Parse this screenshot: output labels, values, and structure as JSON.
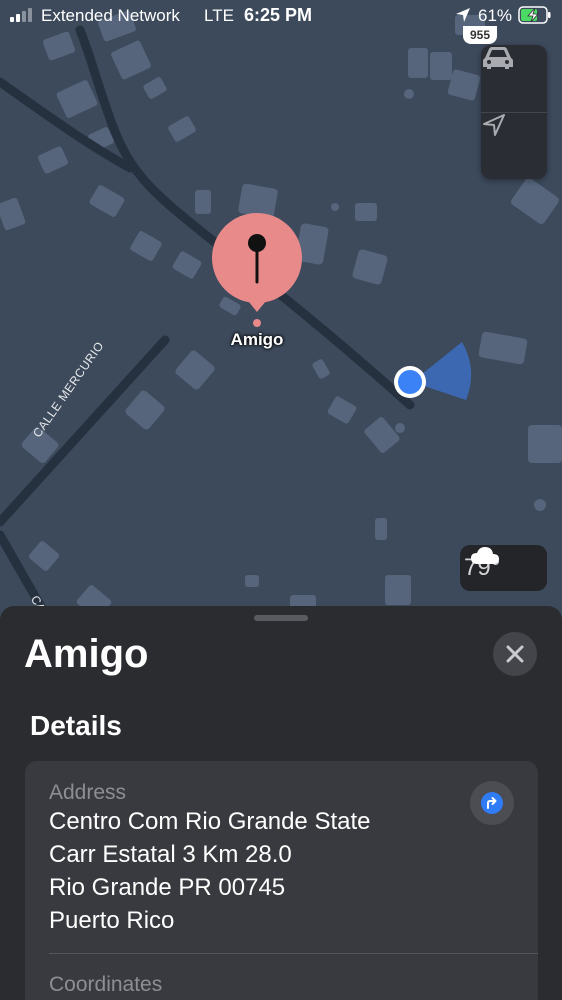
{
  "status_bar": {
    "carrier": "Extended Network",
    "network": "LTE",
    "time": "6:25 PM",
    "battery_percent": "61%",
    "icons": [
      "signal-icon",
      "location-arrow-icon",
      "battery-charging-icon"
    ]
  },
  "map": {
    "route_shield": "955",
    "pin_label": "Amigo",
    "street_label": "CALLE MERCURIO",
    "street_label_2": "CA",
    "weather": {
      "icon": "cloud-icon",
      "temperature": "79°"
    },
    "controls": [
      "car-icon",
      "location-arrow-icon"
    ],
    "colors": {
      "pin": "#e88a8a",
      "user_location": "#3b82f6",
      "map_bg": "#3d4a5c"
    }
  },
  "sheet": {
    "title": "Amigo",
    "section_title": "Details",
    "address_label": "Address",
    "address_lines": [
      "Centro Com Rio Grande State",
      "Carr Estatal 3 Km 28.0",
      "Rio Grande PR 00745",
      "Puerto Rico"
    ],
    "coordinates_label": "Coordinates"
  }
}
